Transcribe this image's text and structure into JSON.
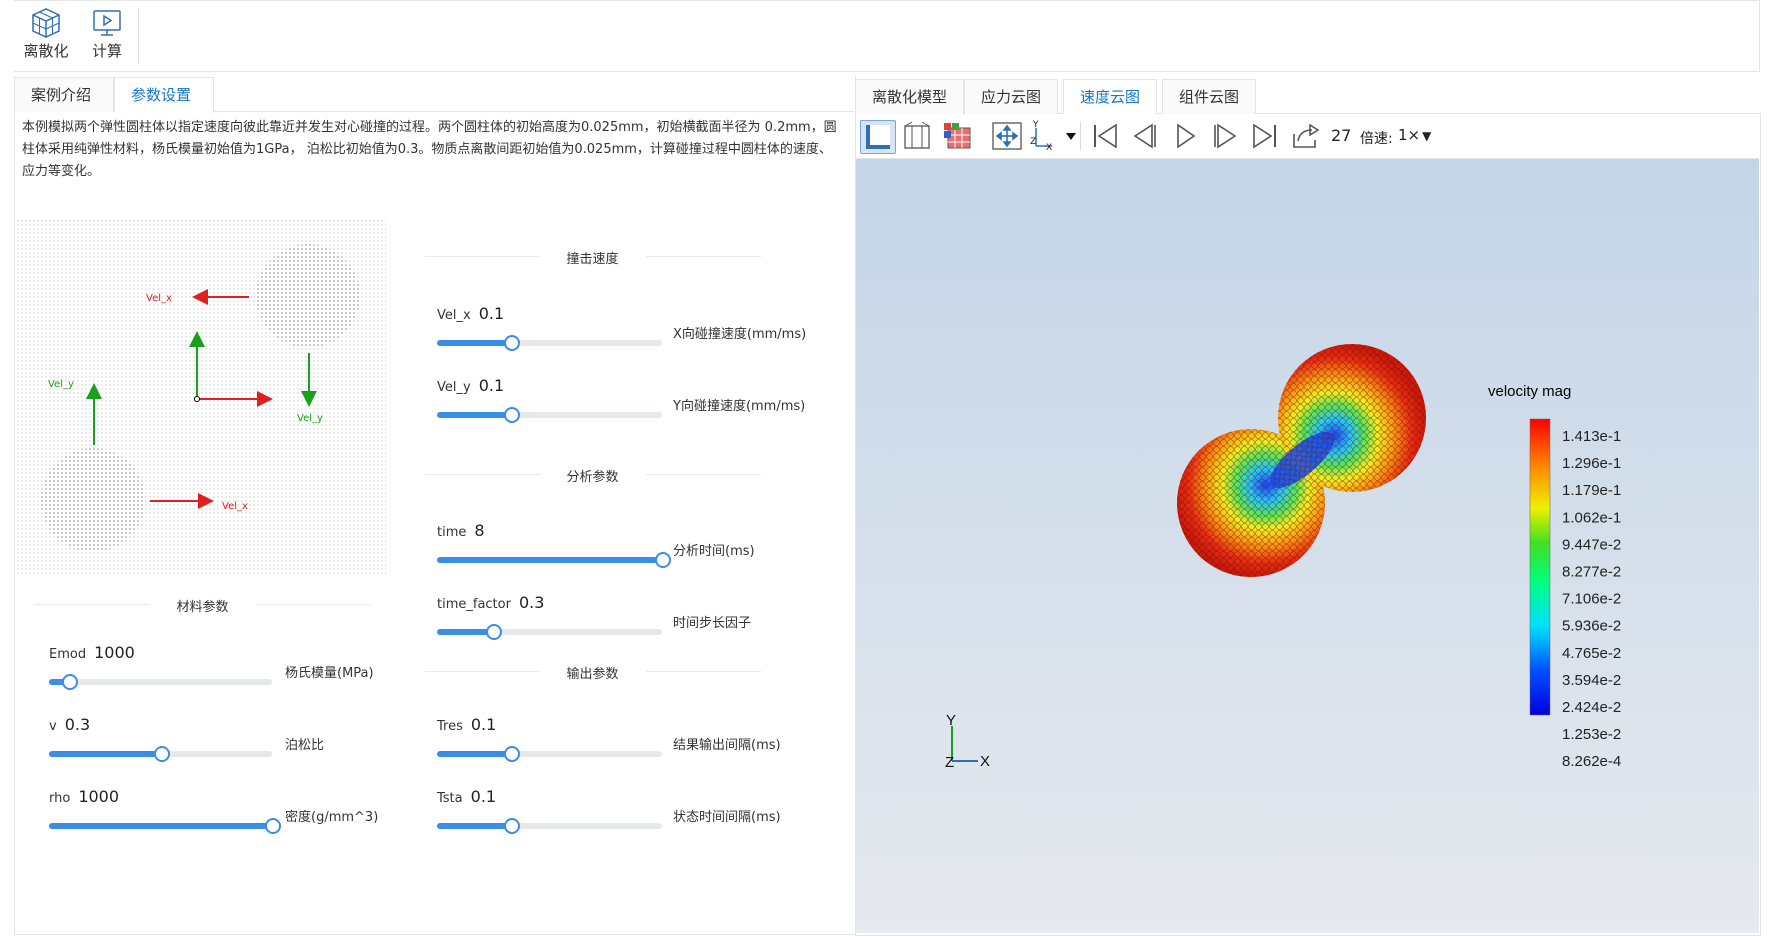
{
  "toolbar": {
    "items": [
      {
        "label": "离散化",
        "icon": "cube-mesh-icon"
      },
      {
        "label": "计算",
        "icon": "monitor-play-icon"
      }
    ]
  },
  "left_tabs": [
    {
      "label": "案例介绍",
      "active": false
    },
    {
      "label": "参数设置",
      "active": true
    }
  ],
  "description": "本例模拟两个弹性圆柱体以指定速度向彼此靠近并发生对心碰撞的过程。两个圆柱体的初始高度为0.025mm，初始横截面半径为 0.2mm，圆柱体采用纯弹性材料，杨氏模量初始值为1GPa， 泊松比初始值为0.3。物质点离散间距初始值为0.025mm，计算碰撞过程中圆柱体的速度、应力等变化。",
  "diagram": {
    "vel_x_top": "Vel_x",
    "vel_x_bottom": "Vel_x",
    "vel_y_left": "Vel_y",
    "vel_y_right": "Vel_y"
  },
  "material": {
    "title": "材料参数",
    "params": [
      {
        "name": "Emod",
        "value": "1000",
        "desc": "杨氏模量(MPa)",
        "fraction": 0.09
      },
      {
        "name": "v",
        "value": "0.3",
        "desc": "泊松比",
        "fraction": 0.5
      },
      {
        "name": "rho",
        "value": "1000",
        "desc": "密度(g/mm^3)",
        "fraction": 1.0
      }
    ]
  },
  "impact": {
    "title": "撞击速度",
    "params": [
      {
        "name": "Vel_x",
        "value": "0.1",
        "desc": "X向碰撞速度(mm/ms)",
        "fraction": 0.33
      },
      {
        "name": "Vel_y",
        "value": "0.1",
        "desc": "Y向碰撞速度(mm/ms)",
        "fraction": 0.33
      }
    ]
  },
  "analysis": {
    "title": "分析参数",
    "params": [
      {
        "name": "time",
        "value": "8",
        "desc": "分析时间(ms)",
        "fraction": 1.0
      },
      {
        "name": "time_factor",
        "value": "0.3",
        "desc": "时间步长因子",
        "fraction": 0.25
      }
    ]
  },
  "output": {
    "title": "输出参数",
    "params": [
      {
        "name": "Tres",
        "value": "0.1",
        "desc": "结果输出间隔(ms)",
        "fraction": 0.33
      },
      {
        "name": "Tsta",
        "value": "0.1",
        "desc": "状态时间间隔(ms)",
        "fraction": 0.33
      }
    ]
  },
  "right_tabs": [
    {
      "label": "离散化模型",
      "active": false
    },
    {
      "label": "应力云图",
      "active": false
    },
    {
      "label": "速度云图",
      "active": true
    },
    {
      "label": "组件云图",
      "active": false
    }
  ],
  "viewer_toolbar": {
    "icons": [
      "solid-view-icon",
      "wireframe-view-icon",
      "grid-cube-icon",
      "fit-view-icon",
      "axes-orientation-icon",
      "first-frame-icon",
      "prev-frame-icon",
      "play-icon",
      "next-frame-icon",
      "last-frame-icon",
      "export-icon"
    ],
    "frame": "27",
    "speed_label": "倍速:",
    "speed_value": "1×"
  },
  "legend": {
    "title": "velocity mag",
    "labels": [
      "1.413e-1",
      "1.296e-1",
      "1.179e-1",
      "1.062e-1",
      "9.447e-2",
      "8.277e-2",
      "7.106e-2",
      "5.936e-2",
      "4.765e-2",
      "3.594e-2",
      "2.424e-2",
      "1.253e-2",
      "8.262e-4"
    ]
  },
  "axes": {
    "y": "Y",
    "x": "X",
    "z": "Z"
  },
  "colors": {
    "accent": "#1677c5",
    "slider": "#3a8ee6",
    "arrow_red": "#e02020",
    "arrow_green": "#1aa01a"
  }
}
